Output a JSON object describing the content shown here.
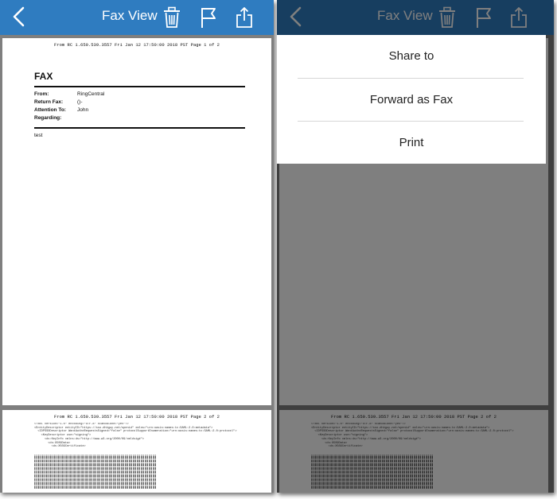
{
  "navbar": {
    "title": "Fax View",
    "icons": {
      "back": "chevron-left-icon",
      "delete": "trash-icon",
      "flag": "flag-icon",
      "share": "share-icon"
    },
    "color": "#2f7cc0"
  },
  "fax": {
    "page1_header": "From RC 1.650.539.3557 Fri Jan 12 17:50:00 2018 PST Page 1 of 2",
    "page2_header": "From RC 1.650.539.3557 Fri Jan 12 17:50:00 2018 PST Page 2 of 2",
    "title": "FAX",
    "fields": [
      {
        "label": "From:",
        "value": "RingCentral"
      },
      {
        "label": "Return Fax:",
        "value": "()-"
      },
      {
        "label": "Attention To:",
        "value": "John"
      },
      {
        "label": "Regarding:",
        "value": ""
      }
    ],
    "body": "test",
    "xml_lines": [
      "<?xml version=\"1.0\" encoding=\"UTF-8\" standalone=\"yes\"?>",
      "<EntityDescriptor entityID=\"https://sso.dhkguy.net/openid\" xmlns=\"urn:oasis:names:tc:SAML:2.0:metadata\">",
      "  <IDPSSODescriptor WantAuthnRequestsSigned=\"false\" protocolSupportEnumeration=\"urn:oasis:names:tc:SAML:2.0:protocol\">",
      "    <KeyDescriptor use=\"signing\">",
      "      <ds:KeyInfo xmlns:ds=\"http://www.w3.org/2000/09/xmldsig#\">",
      "        <ds:X509Data>",
      "          <ds:X509Certificate>"
    ]
  },
  "actions": [
    {
      "label": "Share to"
    },
    {
      "label": "Forward as Fax"
    },
    {
      "label": "Print"
    }
  ]
}
